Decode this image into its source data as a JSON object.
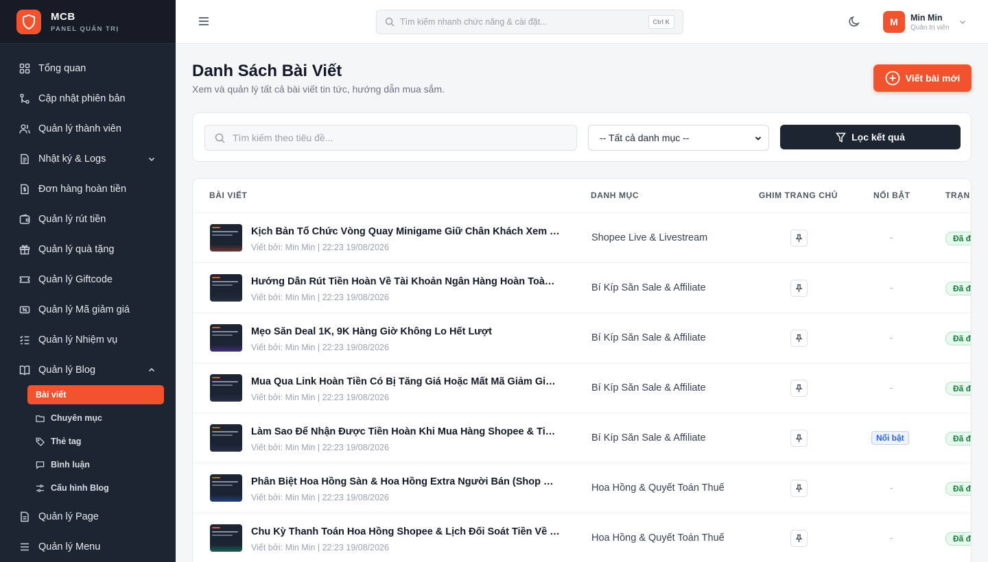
{
  "brand": {
    "title": "MCB",
    "subtitle": "PANEL QUẢN TRỊ"
  },
  "sidebar": {
    "items": [
      {
        "label": "Tổng quan",
        "icon": "dashboard-icon"
      },
      {
        "label": "Cập nhật phiên bản",
        "icon": "git-merge-icon"
      },
      {
        "label": "Quản lý thành viên",
        "icon": "users-icon"
      },
      {
        "label": "Nhật ký & Logs",
        "icon": "log-icon",
        "expandable": true
      },
      {
        "label": "Đơn hàng hoàn tiền",
        "icon": "refund-icon"
      },
      {
        "label": "Quản lý rút tiền",
        "icon": "wallet-icon"
      },
      {
        "label": "Quản lý quà tặng",
        "icon": "gift-icon"
      },
      {
        "label": "Quản lý Giftcode",
        "icon": "ticket-icon"
      },
      {
        "label": "Quản lý Mã giảm giá",
        "icon": "voucher-icon"
      },
      {
        "label": "Quản lý Nhiệm vụ",
        "icon": "checklist-icon"
      },
      {
        "label": "Quản lý Blog",
        "icon": "book-icon",
        "expanded": true
      }
    ],
    "blog_sub": [
      {
        "label": "Bài viết",
        "icon": "",
        "active": true
      },
      {
        "label": "Chuyên mục",
        "icon": "folder-icon"
      },
      {
        "label": "Thẻ tag",
        "icon": "tag-icon"
      },
      {
        "label": "Bình luận",
        "icon": "comment-icon"
      },
      {
        "label": "Cấu hình Blog",
        "icon": "settings-icon"
      }
    ],
    "items_after": [
      {
        "label": "Quản lý Page",
        "icon": "page-icon"
      },
      {
        "label": "Quản lý Menu",
        "icon": "menu-icon"
      }
    ]
  },
  "topbar": {
    "search_placeholder": "Tìm kiếm nhanh chức năng & cài đặt...",
    "shortcut": "Ctrl K",
    "user": {
      "initial": "M",
      "name": "Min Min",
      "role": "Quản trị viên"
    }
  },
  "page": {
    "title": "Danh Sách Bài Viết",
    "subtitle": "Xem và quản lý tất cả bài viết tin tức, hướng dẫn mua sắm.",
    "new_button": "Viết bài mới"
  },
  "filters": {
    "search_placeholder": "Tìm kiếm theo tiêu đề...",
    "category_selected": "-- Tất cả danh mục --",
    "filter_button": "Lọc kết quả"
  },
  "table": {
    "columns": [
      "BÀI VIẾT",
      "DANH MỤC",
      "GHIM TRANG CHỦ",
      "NỔI BẬT",
      "TRẠN"
    ],
    "rows": [
      {
        "title": "Kịch Bản Tổ Chức Vòng Quay Minigame Giữ Chân Khách Xem Live",
        "meta": "Viết bởi: Min Min | 22:23 19/08/2026",
        "category": "Shopee Live & Livestream",
        "featured": "-",
        "status": "Đã đ",
        "thumb_color": "#f0532d"
      },
      {
        "title": "Hướng Dẫn Rút Tiền Hoàn Về Tài Khoản Ngân Hàng Hoàn Toàn Miễn Phí",
        "meta": "Viết bởi: Min Min | 22:23 19/08/2026",
        "category": "Bí Kíp Săn Sale & Affiliate",
        "featured": "-",
        "status": "Đã đ",
        "thumb_color": "#3b3f5c"
      },
      {
        "title": "Mẹo Săn Deal 1K, 9K Hàng Giờ Không Lo Hết Lượt",
        "meta": "Viết bởi: Min Min | 22:23 19/08/2026",
        "category": "Bí Kíp Săn Sale & Affiliate",
        "featured": "-",
        "status": "Đã đ",
        "thumb_color": "#7c3aed"
      },
      {
        "title": "Mua Qua Link Hoàn Tiền Có Bị Tăng Giá Hoặc Mất Mã Giảm Giá Không?",
        "meta": "Viết bởi: Min Min | 22:23 19/08/2026",
        "category": "Bí Kíp Săn Sale & Affiliate",
        "featured": "-",
        "status": "Đã đ",
        "thumb_color": "#3b3f5c"
      },
      {
        "title": "Làm Sao Để Nhận Được Tiền Hoàn Khi Mua Hàng Shopee & TikTok Shop?",
        "meta": "Viết bởi: Min Min | 22:23 19/08/2026",
        "category": "Bí Kíp Săn Sale & Affiliate",
        "featured": "Nổi bật",
        "status": "Đã đ",
        "thumb_color": "#3b3f5c"
      },
      {
        "title": "Phân Biệt Hoa Hồng Sàn & Hoa Hồng Extra Người Bán (Shop Commission)",
        "meta": "Viết bởi: Min Min | 22:23 19/08/2026",
        "category": "Hoa Hồng & Quyết Toán Thuế",
        "featured": "-",
        "status": "Đã đ",
        "thumb_color": "#2563eb"
      },
      {
        "title": "Chu Kỳ Thanh Toán Hoa Hồng Shopee & Lịch Đối Soát Tiền Về Nhanh",
        "meta": "Viết bởi: Min Min | 22:23 19/08/2026",
        "category": "Hoa Hồng & Quyết Toán Thuế",
        "featured": "-",
        "status": "Đã đ",
        "thumb_color": "#10b981"
      }
    ]
  }
}
